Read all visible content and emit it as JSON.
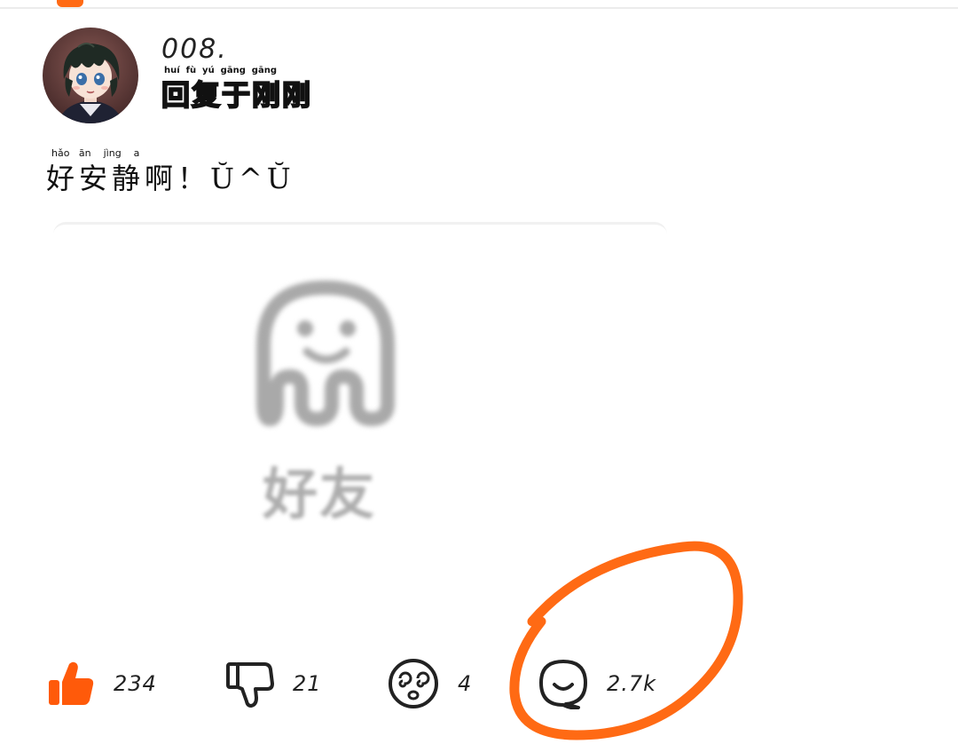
{
  "header": {
    "tab_indicator_color": "#ff6a14"
  },
  "user": {
    "number": "008.",
    "name": "回复于刚刚",
    "name_pinyin": "huí  fù  yú  gāng  gāng",
    "avatar": "anime-character-avatar"
  },
  "post": {
    "text": "好安静啊！",
    "emoticon": "Ŭ^Ŭ",
    "pinyin": "hǎo   ān    jìng    a"
  },
  "media": {
    "placeholder_icon": "ghost-icon",
    "placeholder_text": "好友"
  },
  "actions": {
    "like": {
      "icon": "thumbs-up-icon",
      "count": "234",
      "color": "#ff5a0a"
    },
    "dislike": {
      "icon": "thumbs-down-icon",
      "count": "21"
    },
    "dizzy": {
      "icon": "dizzy-face-icon",
      "count": "4"
    },
    "comment": {
      "icon": "comment-bubble-icon",
      "count": "2.7k"
    }
  },
  "annotation": {
    "color": "#ff6a14"
  }
}
